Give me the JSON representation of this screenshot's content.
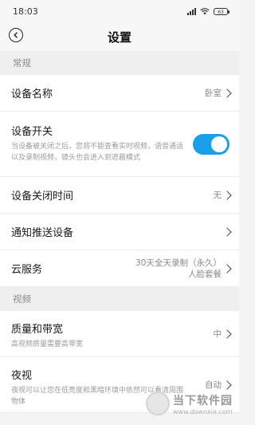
{
  "status": {
    "time": "18:03",
    "battery": "63"
  },
  "nav": {
    "title": "设置"
  },
  "sections": {
    "general": "常规",
    "video": "视频"
  },
  "rows": {
    "device_name": {
      "title": "设备名称",
      "value": "卧室"
    },
    "device_switch": {
      "title": "设备开关",
      "desc": "当设备被关闭之后，您将不能查看实时视频，语音通话以及录制视频，镜头也会进入到遮蔽模式",
      "state": "on"
    },
    "shutdown_time": {
      "title": "设备关闭时间",
      "value": "无"
    },
    "notify_device": {
      "title": "通知推送设备"
    },
    "cloud": {
      "title": "云服务",
      "value_line1": "30天全天录制（永久）",
      "value_line2": "人脸套餐"
    },
    "quality": {
      "title": "质量和带宽",
      "desc": "高视频质量需要高带宽",
      "value": "中"
    },
    "night": {
      "title": "夜视",
      "desc": "夜视可以让您在低亮度和黑暗环境中依然可以看清周围物体",
      "value": "自动"
    }
  },
  "watermark": {
    "text": "当下软件园",
    "sub": "www.downxia.com"
  },
  "colors": {
    "accent": "#1aa0e8",
    "background": "#f4f4f4"
  }
}
